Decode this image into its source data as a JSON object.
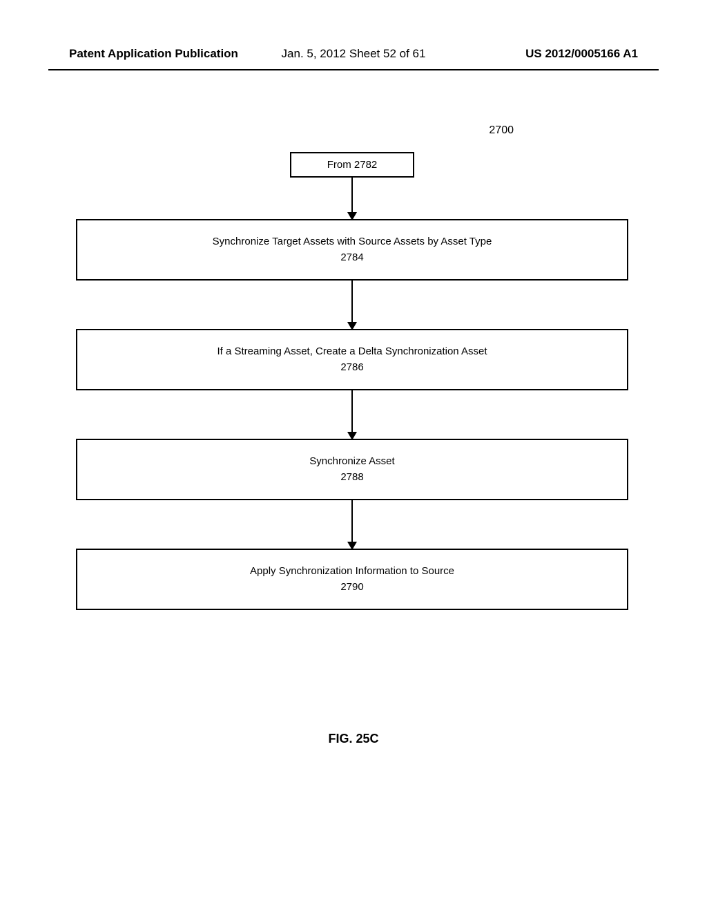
{
  "header": {
    "left": "Patent Application Publication",
    "center": "Jan. 5, 2012   Sheet 52 of 61",
    "right": "US 2012/0005166 A1"
  },
  "reference_number": "2700",
  "flowchart": {
    "start": {
      "label": "From 2782"
    },
    "steps": [
      {
        "text": "Synchronize Target Assets with Source Assets by Asset Type",
        "number": "2784"
      },
      {
        "text": "If a Streaming Asset, Create a Delta Synchronization Asset",
        "number": "2786"
      },
      {
        "text": "Synchronize Asset",
        "number": "2788"
      },
      {
        "text": "Apply Synchronization Information to Source",
        "number": "2790"
      }
    ]
  },
  "figure_label": "FIG. 25C",
  "chart_data": {
    "type": "flowchart",
    "title": "FIG. 25C",
    "reference": "2700",
    "entry_point": "From 2782",
    "nodes": [
      {
        "id": "2782",
        "type": "connector",
        "label": "From 2782"
      },
      {
        "id": "2784",
        "type": "process",
        "label": "Synchronize Target Assets with Source Assets by Asset Type"
      },
      {
        "id": "2786",
        "type": "process",
        "label": "If a Streaming Asset, Create a Delta Synchronization Asset"
      },
      {
        "id": "2788",
        "type": "process",
        "label": "Synchronize Asset"
      },
      {
        "id": "2790",
        "type": "process",
        "label": "Apply Synchronization Information to Source"
      }
    ],
    "edges": [
      {
        "from": "2782",
        "to": "2784"
      },
      {
        "from": "2784",
        "to": "2786"
      },
      {
        "from": "2786",
        "to": "2788"
      },
      {
        "from": "2788",
        "to": "2790"
      }
    ]
  }
}
